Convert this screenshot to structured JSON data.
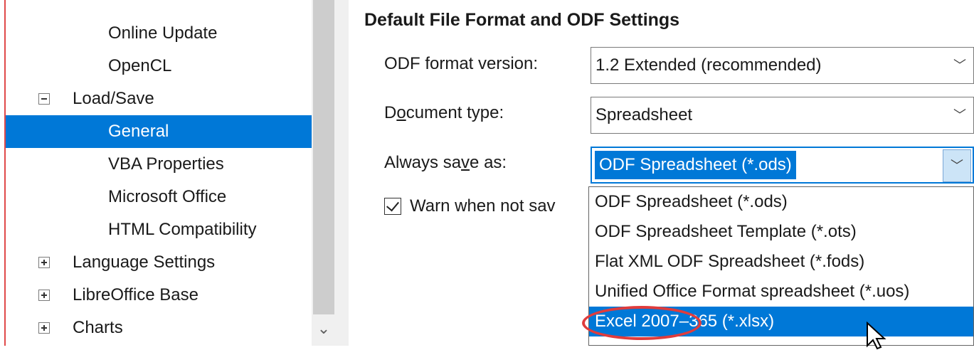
{
  "tree": {
    "items": [
      {
        "label": "Online Update",
        "expander": "",
        "selected": false
      },
      {
        "label": "OpenCL",
        "expander": "",
        "selected": false
      },
      {
        "label": "Load/Save",
        "expander": "minus",
        "selected": false
      },
      {
        "label": "General",
        "expander": "",
        "selected": true
      },
      {
        "label": "VBA Properties",
        "expander": "",
        "selected": false
      },
      {
        "label": "Microsoft Office",
        "expander": "",
        "selected": false
      },
      {
        "label": "HTML Compatibility",
        "expander": "",
        "selected": false
      },
      {
        "label": "Language Settings",
        "expander": "plus",
        "selected": false
      },
      {
        "label": "LibreOffice Base",
        "expander": "plus",
        "selected": false
      },
      {
        "label": "Charts",
        "expander": "plus",
        "selected": false
      }
    ]
  },
  "section": {
    "title": "Default File Format and ODF Settings"
  },
  "fields": {
    "odf_version": {
      "label": "ODF format version:",
      "value": "1.2 Extended (recommended)"
    },
    "doc_type": {
      "label_pre": "D",
      "label_u": "o",
      "label_post": "cument type:",
      "value": "Spreadsheet"
    },
    "save_as": {
      "label_pre": "Always sa",
      "label_u": "v",
      "label_post": "e as:",
      "value": "ODF Spreadsheet (*.ods)"
    }
  },
  "checkbox": {
    "label": "Warn when not sav",
    "checked": true
  },
  "dropdown": {
    "options": [
      "ODF Spreadsheet (*.ods)",
      "ODF Spreadsheet Template (*.ots)",
      "Flat XML ODF Spreadsheet (*.fods)",
      "Unified Office Format spreadsheet (*.uos)",
      "Excel 2007–365 (*.xlsx)"
    ],
    "highlighted_index": 4
  },
  "colors": {
    "accent": "#0078d7",
    "annotation": "#e03c3c"
  }
}
